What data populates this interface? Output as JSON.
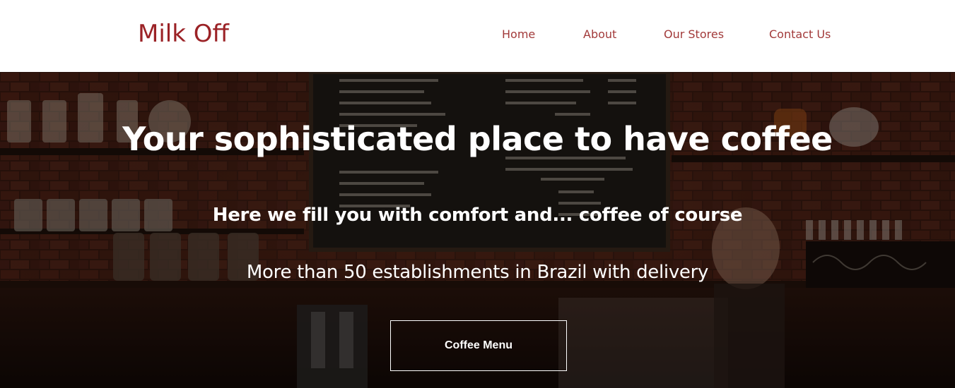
{
  "navbar": {
    "brand": "Milk Off",
    "links": [
      {
        "label": "Home"
      },
      {
        "label": "About"
      },
      {
        "label": "Our Stores"
      },
      {
        "label": "Contact Us"
      }
    ]
  },
  "hero": {
    "title": "Your sophisticated place to have coffee",
    "subtitle": "Here we fill you with comfort and... coffee of course",
    "text": "More than 50 establishments in Brazil with delivery",
    "button_label": "Coffee Menu"
  },
  "colors": {
    "brand": "#9b2226",
    "nav_link": "#a23a3a",
    "hero_text": "#ffffff"
  }
}
